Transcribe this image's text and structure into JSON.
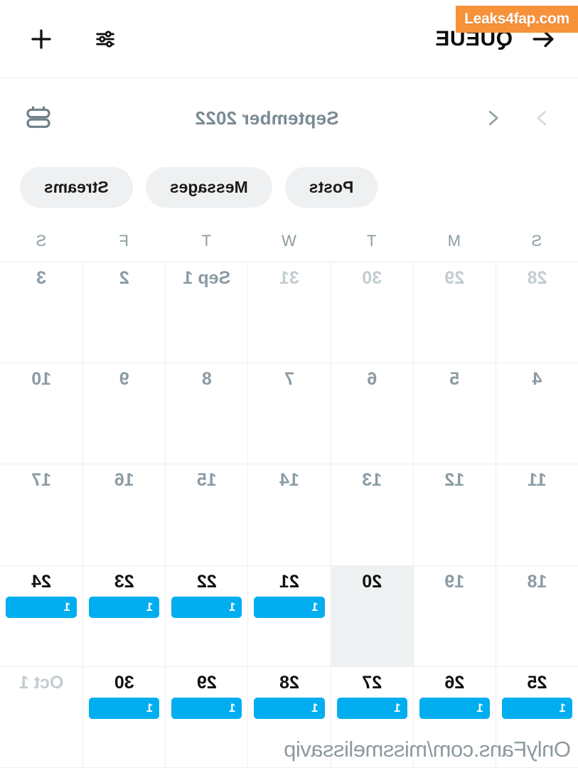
{
  "appbar": {
    "back_icon": "arrow-left-icon",
    "title": "QUEUE",
    "add_icon": "plus-icon",
    "tune_icon": "tune-sliders-icon"
  },
  "month_bar": {
    "prev_icon": "chevron-left-icon",
    "next_icon": "chevron-right-icon",
    "label": "September 2022",
    "calendar_icon": "calendar-icon"
  },
  "filters": {
    "chips": [
      {
        "label": "Posts"
      },
      {
        "label": "Messages"
      },
      {
        "label": "Streams"
      }
    ]
  },
  "calendar": {
    "weekdays": [
      "S",
      "M",
      "T",
      "W",
      "T",
      "F",
      "S"
    ],
    "accent_color": "#00aeef",
    "today_bg": "#eef2f3",
    "days": [
      {
        "num": "28",
        "state": "other-month",
        "events": 0
      },
      {
        "num": "29",
        "state": "other-month",
        "events": 0
      },
      {
        "num": "30",
        "state": "other-month",
        "events": 0
      },
      {
        "num": "31",
        "state": "other-month",
        "events": 0
      },
      {
        "num": "Sep 1",
        "state": "past",
        "events": 0
      },
      {
        "num": "2",
        "state": "past",
        "events": 0
      },
      {
        "num": "3",
        "state": "past",
        "events": 0
      },
      {
        "num": "4",
        "state": "past",
        "events": 0
      },
      {
        "num": "5",
        "state": "past",
        "events": 0
      },
      {
        "num": "6",
        "state": "past",
        "events": 0
      },
      {
        "num": "7",
        "state": "past",
        "events": 0
      },
      {
        "num": "8",
        "state": "past",
        "events": 0
      },
      {
        "num": "9",
        "state": "past",
        "events": 0
      },
      {
        "num": "10",
        "state": "past",
        "events": 0
      },
      {
        "num": "11",
        "state": "past",
        "events": 0
      },
      {
        "num": "12",
        "state": "past",
        "events": 0
      },
      {
        "num": "13",
        "state": "past",
        "events": 0
      },
      {
        "num": "14",
        "state": "past",
        "events": 0
      },
      {
        "num": "15",
        "state": "past",
        "events": 0
      },
      {
        "num": "16",
        "state": "past",
        "events": 0
      },
      {
        "num": "17",
        "state": "past",
        "events": 0
      },
      {
        "num": "18",
        "state": "past",
        "events": 0
      },
      {
        "num": "19",
        "state": "past",
        "events": 0
      },
      {
        "num": "20",
        "state": "today",
        "events": 0
      },
      {
        "num": "21",
        "state": "current",
        "events": 1,
        "event_label": "1"
      },
      {
        "num": "22",
        "state": "current",
        "events": 1,
        "event_label": "1"
      },
      {
        "num": "23",
        "state": "current",
        "events": 1,
        "event_label": "1"
      },
      {
        "num": "24",
        "state": "current",
        "events": 1,
        "event_label": "1"
      },
      {
        "num": "25",
        "state": "current",
        "events": 1,
        "event_label": "1"
      },
      {
        "num": "26",
        "state": "current",
        "events": 1,
        "event_label": "1"
      },
      {
        "num": "27",
        "state": "current",
        "events": 1,
        "event_label": "1"
      },
      {
        "num": "28",
        "state": "current",
        "events": 1,
        "event_label": "1"
      },
      {
        "num": "29",
        "state": "current",
        "events": 1,
        "event_label": "1"
      },
      {
        "num": "30",
        "state": "current",
        "events": 1,
        "event_label": "1"
      },
      {
        "num": "Oct 1",
        "state": "other-month",
        "events": 0
      }
    ]
  },
  "overlays": {
    "brand_badge": "Leaks4fap.com",
    "brand_badge_color": "#f7923a",
    "url_watermark": "OnlyFans.com/missmelissavip"
  }
}
